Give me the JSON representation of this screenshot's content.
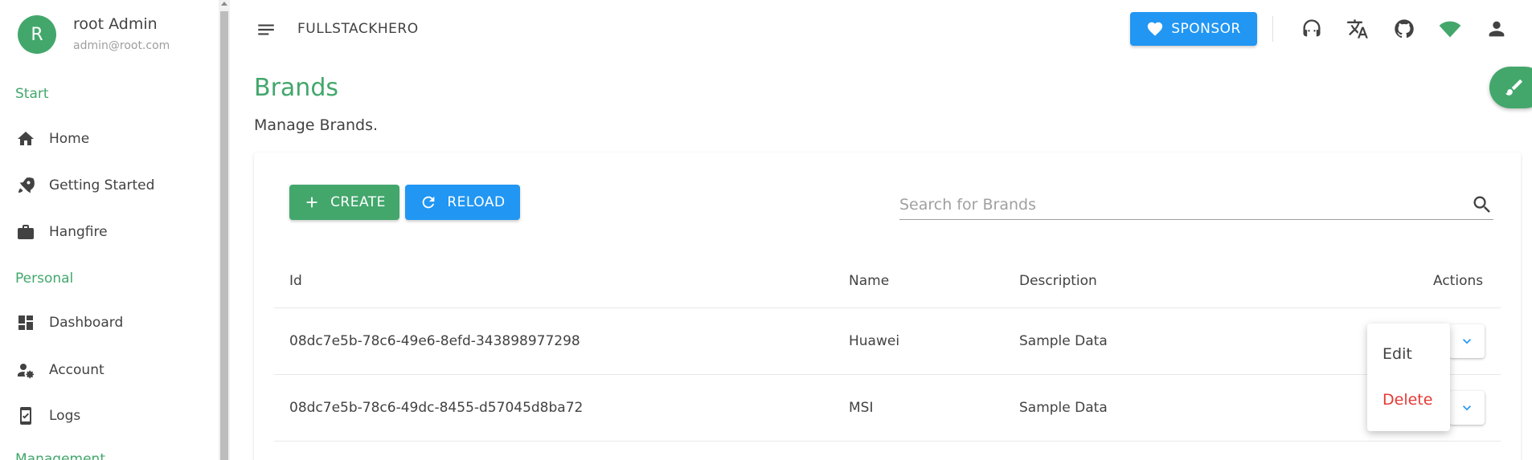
{
  "user": {
    "initial": "R",
    "name": "root Admin",
    "email": "admin@root.com"
  },
  "sidebar": {
    "sections": [
      "Start",
      "Personal",
      "Management"
    ],
    "items": [
      {
        "label": "Home",
        "icon": "home-icon"
      },
      {
        "label": "Getting Started",
        "icon": "rocket-icon"
      },
      {
        "label": "Hangfire",
        "icon": "briefcase-icon"
      },
      {
        "label": "Dashboard",
        "icon": "dashboard-icon"
      },
      {
        "label": "Account",
        "icon": "account-settings-icon"
      },
      {
        "label": "Logs",
        "icon": "logs-icon"
      }
    ]
  },
  "topbar": {
    "brand": "FULLSTACKHERO",
    "sponsor_label": "SPONSOR",
    "icons": [
      "support-icon",
      "translate-icon",
      "github-icon",
      "wifi-icon",
      "user-icon"
    ]
  },
  "page": {
    "title": "Brands",
    "subtitle": "Manage Brands."
  },
  "toolbar": {
    "create_label": "CREATE",
    "reload_label": "RELOAD",
    "search_placeholder": "Search for Brands"
  },
  "table": {
    "headers": [
      "Id",
      "Name",
      "Description",
      "Actions"
    ],
    "rows": [
      {
        "id": "08dc7e5b-78c6-49e6-8efd-343898977298",
        "name": "Huawei",
        "description": "Sample Data"
      },
      {
        "id": "08dc7e5b-78c6-49dc-8455-d57045d8ba72",
        "name": "MSI",
        "description": "Sample Data"
      }
    ]
  },
  "actions_menu": {
    "edit_label": "Edit",
    "delete_label": "Delete"
  },
  "colors": {
    "primary": "#43a76c",
    "info": "#2196f3",
    "danger": "#e53935"
  }
}
